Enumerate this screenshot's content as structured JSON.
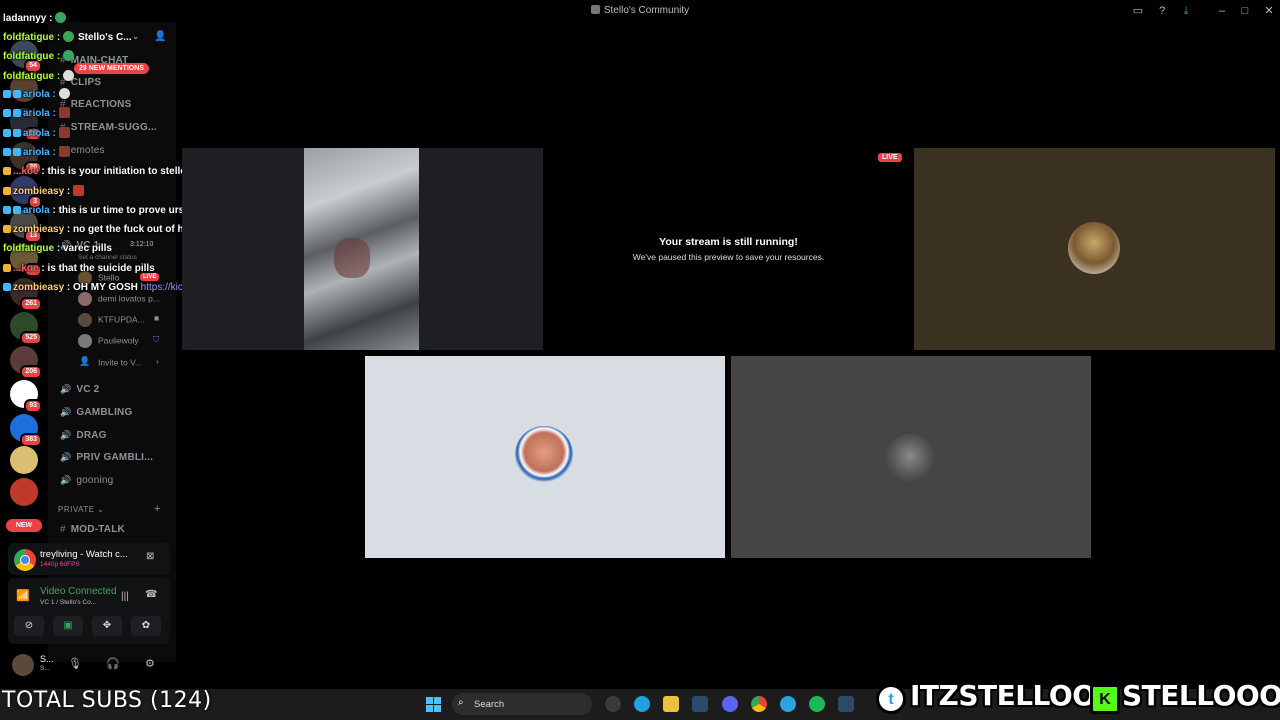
{
  "window": {
    "title": "Stello's Community"
  },
  "server": {
    "name": "Stello's C...",
    "mentions": "29 NEW MENTIONS"
  },
  "rail": {
    "badges": [
      "54",
      "22",
      "20",
      "3",
      "13",
      "3",
      "40",
      "29",
      "261",
      "525",
      "206",
      "93",
      "383"
    ],
    "new_label": "NEW"
  },
  "channels": {
    "main_chat": "MAIN-CHAT",
    "clips": "CLIPS",
    "reactions": "REACTIONS",
    "stream_sugg": "STREAM-SUGG...",
    "emotes": "emotes",
    "vc1": "VC 1",
    "vc2": "VC 2",
    "gambling": "GAMBLING",
    "drag": "DRAG",
    "priv_gambling": "PRIV GAMBLI...",
    "gooning": "gooning",
    "private_category": "PRIVATE",
    "mod_talk": "MOD-TALK"
  },
  "voice_channel": {
    "timer": "3:12:10",
    "status_hint": "Set a channel status",
    "live": "LIVE",
    "users": [
      {
        "name": "Stello"
      },
      {
        "name": "demi lovatos p..."
      },
      {
        "name": "KTFUPDA..."
      },
      {
        "name": "Pauliewoly"
      },
      {
        "name": "Invite to V..."
      }
    ]
  },
  "chat": [
    {
      "user": "ladannyy",
      "text": "",
      "color": "#ffffff"
    },
    {
      "user": "foldfatigue",
      "text": "",
      "color": "#b3ff3f"
    },
    {
      "user": "foldfatigue",
      "text": "",
      "color": "#b3ff3f"
    },
    {
      "user": "ariola",
      "text": "",
      "color": "#3fb8ff"
    },
    {
      "user": "ariola",
      "text": "",
      "color": "#3fb8ff"
    },
    {
      "user": "ariola",
      "text": "",
      "color": "#3fb8ff"
    },
    {
      "user": "...koe",
      "text": "this is your initiation to stello ****** gang",
      "color": "#ff5a5a"
    },
    {
      "user": "zombieasy",
      "text": "",
      "color": "#ffd166"
    },
    {
      "user": "ariola",
      "text": "this is ur time to prove urself to us bt",
      "color": "#3fb8ff"
    },
    {
      "user": "zombieasy",
      "text": "no get the fuck out of here bt",
      "color": "#ffd166"
    },
    {
      "user": "foldfatigue",
      "text": "varec pills",
      "color": "#b3ff3f"
    },
    {
      "user": "...koe",
      "text": "is that the suicide pills",
      "color": "#ff5a5a"
    },
    {
      "user": "zombieasy",
      "text": "OH MY GOSH",
      "link": "https://kick.com/varec",
      "color": "#ffd166"
    }
  ],
  "activity": {
    "title": "treyliving - Watch c...",
    "quality": "1440p 60FPS"
  },
  "voice_status": {
    "label": "Video Connected",
    "sub": "VC 1 / Stello's Co..."
  },
  "user": {
    "name": "S...",
    "status": "S..."
  },
  "stage": {
    "paused_title": "Your stream is still running!",
    "paused_sub": "We've paused this preview to save your resources.",
    "live_tag": "LIVE"
  },
  "overlay": {
    "subs": "TOTAL SUBS (124)",
    "twitter": "ITZSTELLOO",
    "kick": "STELLOOO"
  },
  "taskbar": {
    "search": "Search"
  }
}
